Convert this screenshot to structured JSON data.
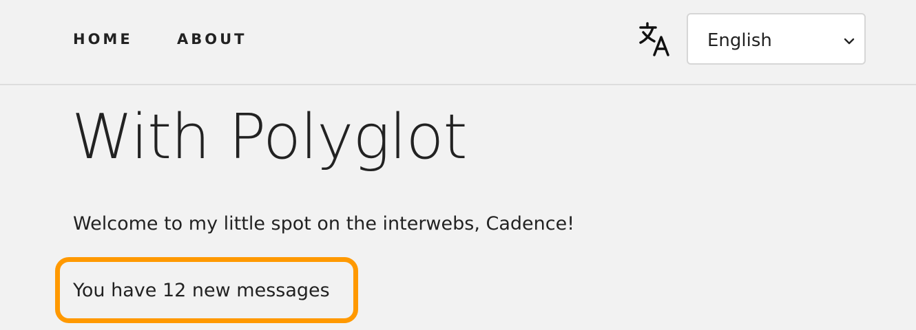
{
  "nav": {
    "items": [
      {
        "label": "HOME"
      },
      {
        "label": "ABOUT"
      }
    ]
  },
  "language": {
    "icon": "translate-icon",
    "selected": "English"
  },
  "main": {
    "title": "With Polyglot",
    "welcome": "Welcome to my little spot on the interwebs, Cadence!",
    "messages": "You have 12 new messages"
  },
  "colors": {
    "background": "#f2f2f2",
    "text": "#222222",
    "highlight": "#ff9900"
  }
}
